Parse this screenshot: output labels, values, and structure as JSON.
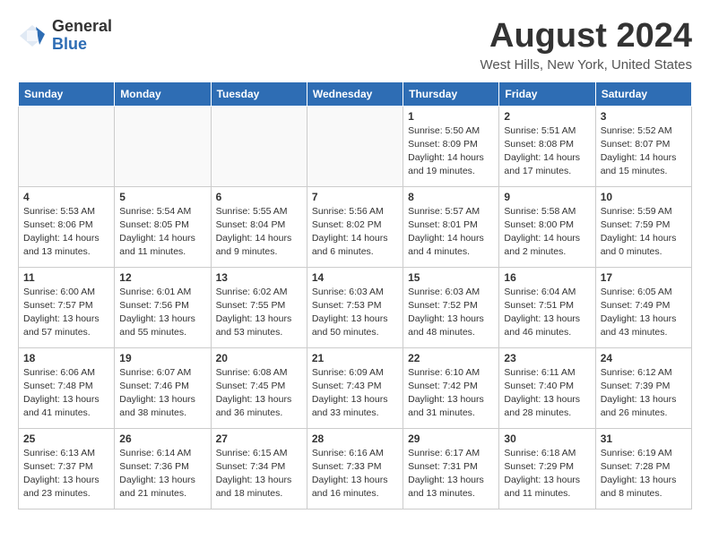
{
  "header": {
    "logo_general": "General",
    "logo_blue": "Blue",
    "month_title": "August 2024",
    "location": "West Hills, New York, United States"
  },
  "weekdays": [
    "Sunday",
    "Monday",
    "Tuesday",
    "Wednesday",
    "Thursday",
    "Friday",
    "Saturday"
  ],
  "weeks": [
    [
      {
        "day": "",
        "detail": ""
      },
      {
        "day": "",
        "detail": ""
      },
      {
        "day": "",
        "detail": ""
      },
      {
        "day": "",
        "detail": ""
      },
      {
        "day": "1",
        "detail": "Sunrise: 5:50 AM\nSunset: 8:09 PM\nDaylight: 14 hours\nand 19 minutes."
      },
      {
        "day": "2",
        "detail": "Sunrise: 5:51 AM\nSunset: 8:08 PM\nDaylight: 14 hours\nand 17 minutes."
      },
      {
        "day": "3",
        "detail": "Sunrise: 5:52 AM\nSunset: 8:07 PM\nDaylight: 14 hours\nand 15 minutes."
      }
    ],
    [
      {
        "day": "4",
        "detail": "Sunrise: 5:53 AM\nSunset: 8:06 PM\nDaylight: 14 hours\nand 13 minutes."
      },
      {
        "day": "5",
        "detail": "Sunrise: 5:54 AM\nSunset: 8:05 PM\nDaylight: 14 hours\nand 11 minutes."
      },
      {
        "day": "6",
        "detail": "Sunrise: 5:55 AM\nSunset: 8:04 PM\nDaylight: 14 hours\nand 9 minutes."
      },
      {
        "day": "7",
        "detail": "Sunrise: 5:56 AM\nSunset: 8:02 PM\nDaylight: 14 hours\nand 6 minutes."
      },
      {
        "day": "8",
        "detail": "Sunrise: 5:57 AM\nSunset: 8:01 PM\nDaylight: 14 hours\nand 4 minutes."
      },
      {
        "day": "9",
        "detail": "Sunrise: 5:58 AM\nSunset: 8:00 PM\nDaylight: 14 hours\nand 2 minutes."
      },
      {
        "day": "10",
        "detail": "Sunrise: 5:59 AM\nSunset: 7:59 PM\nDaylight: 14 hours\nand 0 minutes."
      }
    ],
    [
      {
        "day": "11",
        "detail": "Sunrise: 6:00 AM\nSunset: 7:57 PM\nDaylight: 13 hours\nand 57 minutes."
      },
      {
        "day": "12",
        "detail": "Sunrise: 6:01 AM\nSunset: 7:56 PM\nDaylight: 13 hours\nand 55 minutes."
      },
      {
        "day": "13",
        "detail": "Sunrise: 6:02 AM\nSunset: 7:55 PM\nDaylight: 13 hours\nand 53 minutes."
      },
      {
        "day": "14",
        "detail": "Sunrise: 6:03 AM\nSunset: 7:53 PM\nDaylight: 13 hours\nand 50 minutes."
      },
      {
        "day": "15",
        "detail": "Sunrise: 6:03 AM\nSunset: 7:52 PM\nDaylight: 13 hours\nand 48 minutes."
      },
      {
        "day": "16",
        "detail": "Sunrise: 6:04 AM\nSunset: 7:51 PM\nDaylight: 13 hours\nand 46 minutes."
      },
      {
        "day": "17",
        "detail": "Sunrise: 6:05 AM\nSunset: 7:49 PM\nDaylight: 13 hours\nand 43 minutes."
      }
    ],
    [
      {
        "day": "18",
        "detail": "Sunrise: 6:06 AM\nSunset: 7:48 PM\nDaylight: 13 hours\nand 41 minutes."
      },
      {
        "day": "19",
        "detail": "Sunrise: 6:07 AM\nSunset: 7:46 PM\nDaylight: 13 hours\nand 38 minutes."
      },
      {
        "day": "20",
        "detail": "Sunrise: 6:08 AM\nSunset: 7:45 PM\nDaylight: 13 hours\nand 36 minutes."
      },
      {
        "day": "21",
        "detail": "Sunrise: 6:09 AM\nSunset: 7:43 PM\nDaylight: 13 hours\nand 33 minutes."
      },
      {
        "day": "22",
        "detail": "Sunrise: 6:10 AM\nSunset: 7:42 PM\nDaylight: 13 hours\nand 31 minutes."
      },
      {
        "day": "23",
        "detail": "Sunrise: 6:11 AM\nSunset: 7:40 PM\nDaylight: 13 hours\nand 28 minutes."
      },
      {
        "day": "24",
        "detail": "Sunrise: 6:12 AM\nSunset: 7:39 PM\nDaylight: 13 hours\nand 26 minutes."
      }
    ],
    [
      {
        "day": "25",
        "detail": "Sunrise: 6:13 AM\nSunset: 7:37 PM\nDaylight: 13 hours\nand 23 minutes."
      },
      {
        "day": "26",
        "detail": "Sunrise: 6:14 AM\nSunset: 7:36 PM\nDaylight: 13 hours\nand 21 minutes."
      },
      {
        "day": "27",
        "detail": "Sunrise: 6:15 AM\nSunset: 7:34 PM\nDaylight: 13 hours\nand 18 minutes."
      },
      {
        "day": "28",
        "detail": "Sunrise: 6:16 AM\nSunset: 7:33 PM\nDaylight: 13 hours\nand 16 minutes."
      },
      {
        "day": "29",
        "detail": "Sunrise: 6:17 AM\nSunset: 7:31 PM\nDaylight: 13 hours\nand 13 minutes."
      },
      {
        "day": "30",
        "detail": "Sunrise: 6:18 AM\nSunset: 7:29 PM\nDaylight: 13 hours\nand 11 minutes."
      },
      {
        "day": "31",
        "detail": "Sunrise: 6:19 AM\nSunset: 7:28 PM\nDaylight: 13 hours\nand 8 minutes."
      }
    ]
  ]
}
